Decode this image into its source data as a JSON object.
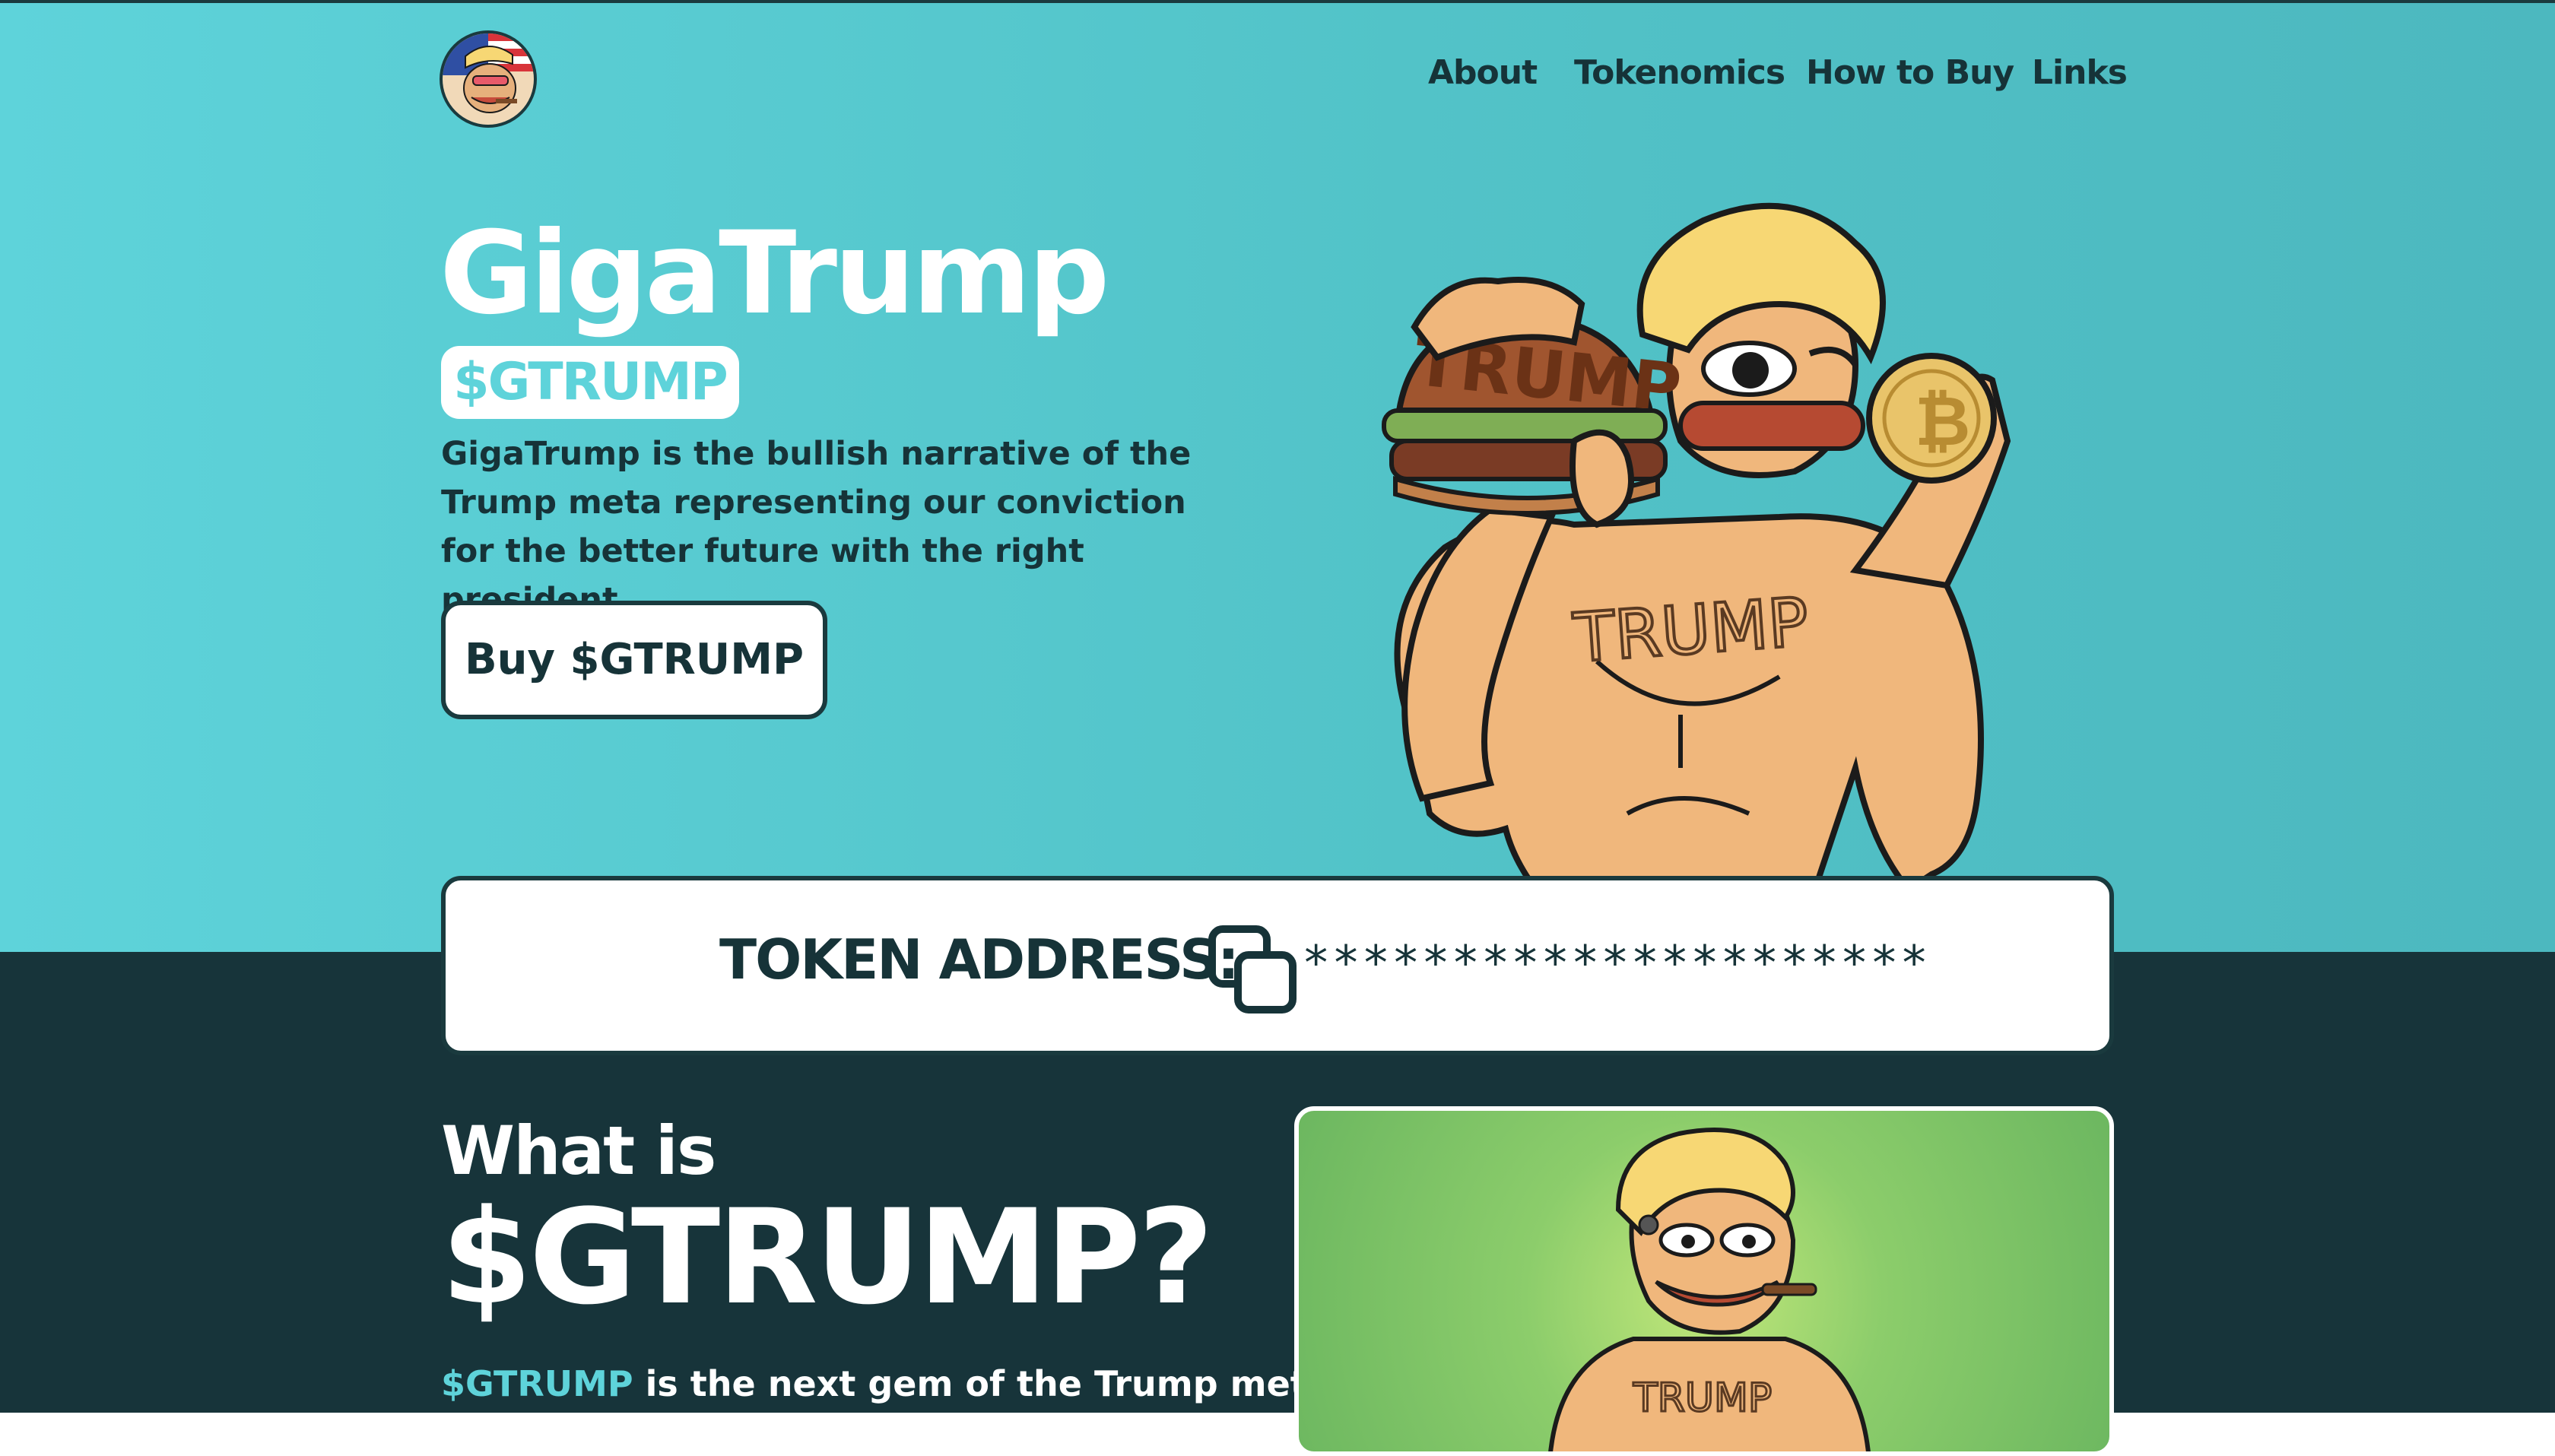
{
  "nav": {
    "items": [
      {
        "label": "About"
      },
      {
        "label": "Tokenomics"
      },
      {
        "label": "How to Buy"
      },
      {
        "label": "Links"
      }
    ]
  },
  "hero": {
    "title": "GigaTrump",
    "ticker": "$GTRUMP",
    "description": "GigaTrump is the bullish narrative of the Trump meta representing our conviction for the better future with the right president.",
    "buy_button": "Buy $GTRUMP"
  },
  "token": {
    "label": "TOKEN ADDRESS:",
    "value": "*********************"
  },
  "about": {
    "heading_small": "What is",
    "heading_big": "$GTRUMP?",
    "description_accent": "$GTRUMP",
    "description_rest": " is the next gem of the Trump meta,"
  },
  "colors": {
    "accent": "#5ed3da",
    "dark": "#17343a",
    "text_dark": "#163338"
  }
}
